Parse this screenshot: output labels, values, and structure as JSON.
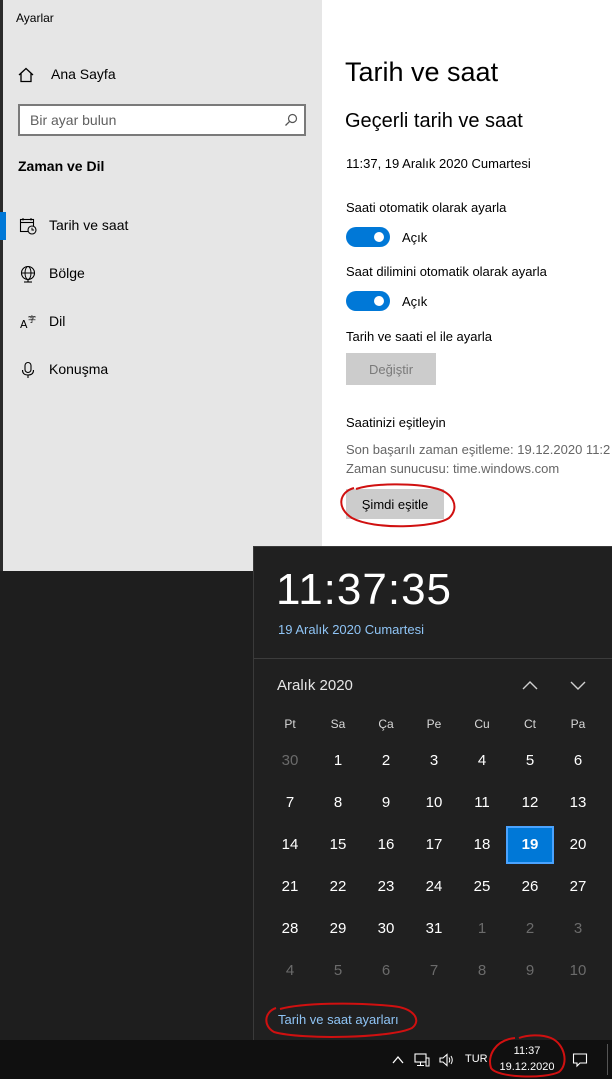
{
  "window": {
    "title": "Ayarlar"
  },
  "nav": {
    "home_label": "Ana Sayfa",
    "search_placeholder": "Bir ayar bulun",
    "section": "Zaman ve Dil",
    "items": [
      {
        "label": "Tarih ve saat",
        "icon": "calendar-clock-icon",
        "active": true
      },
      {
        "label": "Bölge",
        "icon": "globe-icon",
        "active": false
      },
      {
        "label": "Dil",
        "icon": "language-icon",
        "active": false
      },
      {
        "label": "Konuşma",
        "icon": "microphone-icon",
        "active": false
      }
    ]
  },
  "content": {
    "title": "Tarih ve saat",
    "subtitle": "Geçerli tarih ve saat",
    "current_datetime": "11:37, 19 Aralık 2020 Cumartesi",
    "auto_time_label": "Saati otomatik olarak ayarla",
    "auto_time_state": "Açık",
    "auto_zone_label": "Saat dilimini otomatik olarak ayarla",
    "auto_zone_state": "Açık",
    "manual_label": "Tarih ve saati el ile ayarla",
    "change_button": "Değiştir",
    "sync_title": "Saatinizi eşitleyin",
    "last_sync": "Son başarılı zaman eşitleme:  19.12.2020 11:2",
    "time_server": "Zaman sunucusu:  time.windows.com",
    "sync_button": "Şimdi eşitle"
  },
  "flyout": {
    "time": "11:37:35",
    "date": "19 Aralık 2020 Cumartesi",
    "month": "Aralık 2020",
    "weekdays": [
      "Pt",
      "Sa",
      "Ça",
      "Pe",
      "Cu",
      "Ct",
      "Pa"
    ],
    "weeks": [
      [
        "30",
        "1",
        "2",
        "3",
        "4",
        "5",
        "6"
      ],
      [
        "7",
        "8",
        "9",
        "10",
        "11",
        "12",
        "13"
      ],
      [
        "14",
        "15",
        "16",
        "17",
        "18",
        "19",
        "20"
      ],
      [
        "21",
        "22",
        "23",
        "24",
        "25",
        "26",
        "27"
      ],
      [
        "28",
        "29",
        "30",
        "31",
        "1",
        "2",
        "3"
      ],
      [
        "4",
        "5",
        "6",
        "7",
        "8",
        "9",
        "10"
      ]
    ],
    "selected_day": "19",
    "settings_link": "Tarih ve saat ayarları"
  },
  "taskbar": {
    "language": "TUR",
    "time": "11:37",
    "date": "19.12.2020"
  },
  "colors": {
    "accent": "#0078d7",
    "link": "#8fc4f5",
    "annotation": "#d01010"
  }
}
